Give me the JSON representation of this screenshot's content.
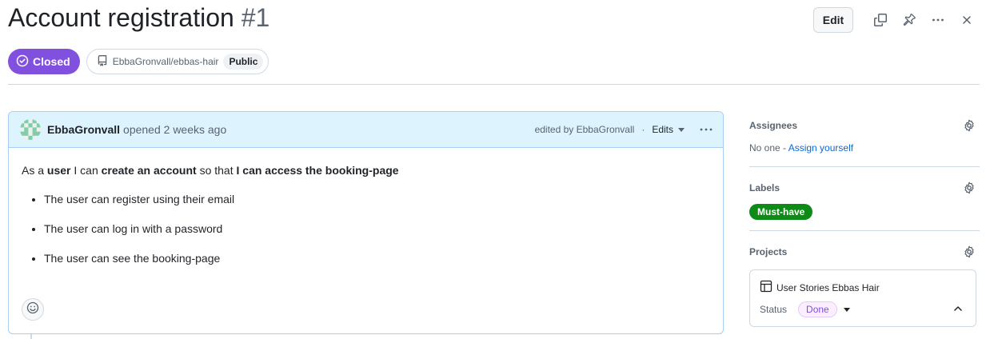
{
  "issue": {
    "title": "Account registration",
    "number": "#1",
    "state": "Closed",
    "repo": "EbbaGronvall/ebbas-hair",
    "visibility": "Public",
    "edit_label": "Edit"
  },
  "comment": {
    "author": "EbbaGronvall",
    "opened_text": "opened 2 weeks ago",
    "edited_by": "edited by EbbaGronvall",
    "separator": "·",
    "edits_label": "Edits",
    "body": {
      "p1": "As a ",
      "p2": "user",
      "p3": " I can ",
      "p4": "create an account",
      "p5": " so that ",
      "p6": "I can access the booking-page"
    },
    "items": [
      "The user can register using their email",
      "The user can log in with a password",
      "The user can see the booking-page"
    ]
  },
  "sidebar": {
    "assignees": {
      "title": "Assignees",
      "none": "No one - ",
      "assign_link": "Assign yourself"
    },
    "labels": {
      "title": "Labels",
      "label": "Must-have",
      "label_color": "#0e8a16"
    },
    "projects": {
      "title": "Projects",
      "project_name": "User Stories Ebbas Hair",
      "status_label": "Status",
      "status_value": "Done"
    }
  },
  "colors": {
    "closed_badge": "#8250df",
    "link": "#0969da",
    "header_bg": "#ddf4ff"
  },
  "icons": [
    "check-circle-icon",
    "repo-icon",
    "copy-icon",
    "pin-icon",
    "kebab-icon",
    "close-icon",
    "chevron-down-icon",
    "gear-icon",
    "table-icon",
    "chevron-up-icon",
    "smiley-icon"
  ]
}
